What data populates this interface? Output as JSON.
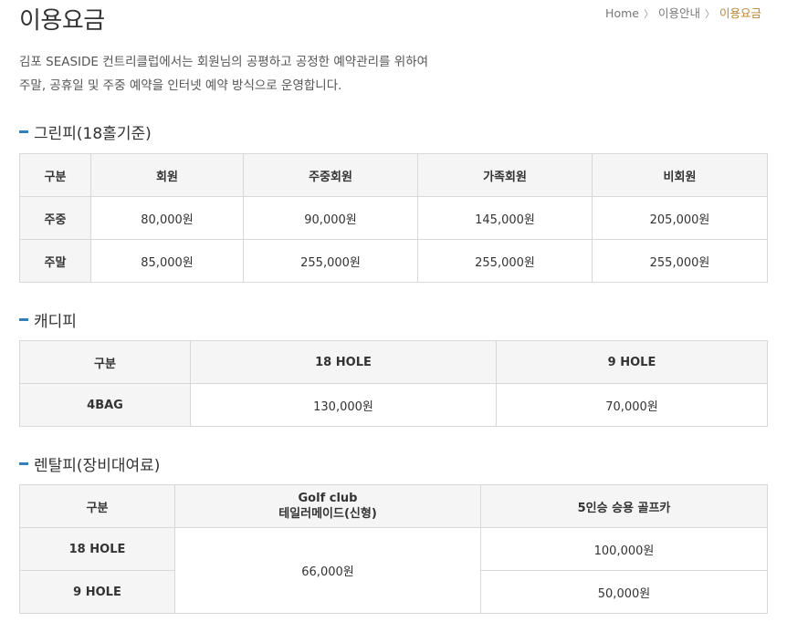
{
  "page_title": "이용요금",
  "breadcrumb": {
    "home": "Home",
    "parent": "이용안내",
    "current": "이용요금"
  },
  "intro": {
    "line1": "김포 SEASIDE 컨트리클럽에서는 회원님의 공평하고 공정한 예약관리를 위하여",
    "line2": "주말, 공휴일 및 주중 예약을 인터넷 예약 방식으로 운영합니다."
  },
  "green_fee": {
    "title": "그린피(18홀기준)",
    "headers": [
      "구분",
      "회원",
      "주중회원",
      "가족회원",
      "비회원"
    ],
    "rows": [
      {
        "label": "주중",
        "values": [
          "80,000원",
          "90,000원",
          "145,000원",
          "205,000원"
        ]
      },
      {
        "label": "주말",
        "values": [
          "85,000원",
          "255,000원",
          "255,000원",
          "255,000원"
        ]
      }
    ]
  },
  "caddie_fee": {
    "title": "캐디피",
    "headers": [
      "구분",
      "18 HOLE",
      "9 HOLE"
    ],
    "rows": [
      {
        "label": "4BAG",
        "values": [
          "130,000원",
          "70,000원"
        ]
      }
    ]
  },
  "rental_fee": {
    "title": "렌탈피(장비대여료)",
    "headers": [
      "구분",
      "Golf club",
      "테일러메이드(신형)",
      "5인승 승용 골프카"
    ],
    "rows": [
      {
        "label": "18 HOLE",
        "club": "66,000원",
        "cart": "100,000원"
      },
      {
        "label": "9 HOLE",
        "cart": "50,000원"
      }
    ]
  },
  "colors": {
    "accent_bar": "#2f7fc1",
    "breadcrumb_current": "#c0832a",
    "header_bg": "#f5f5f5",
    "border": "#d8d8d8"
  }
}
